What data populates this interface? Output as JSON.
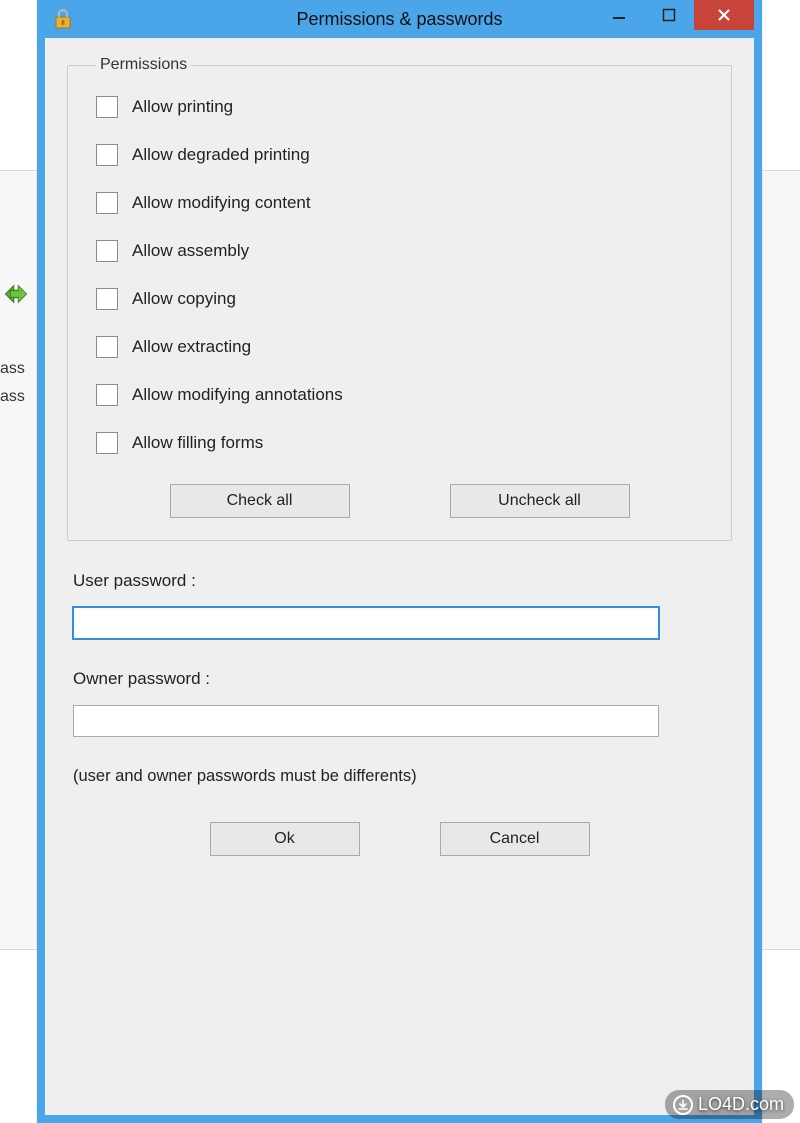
{
  "window": {
    "title": "Permissions & passwords"
  },
  "permissions_group": {
    "legend": "Permissions",
    "items": [
      {
        "label": "Allow printing",
        "checked": false
      },
      {
        "label": "Allow degraded printing",
        "checked": false
      },
      {
        "label": "Allow modifying content",
        "checked": false
      },
      {
        "label": "Allow assembly",
        "checked": false
      },
      {
        "label": "Allow copying",
        "checked": false
      },
      {
        "label": "Allow extracting",
        "checked": false
      },
      {
        "label": "Allow modifying annotations",
        "checked": false
      },
      {
        "label": "Allow filling forms",
        "checked": false
      }
    ],
    "check_all_label": "Check all",
    "uncheck_all_label": "Uncheck all"
  },
  "user_password": {
    "label": "User password :",
    "value": ""
  },
  "owner_password": {
    "label": "Owner password :",
    "value": ""
  },
  "hint_text": "(user and owner passwords must be differents)",
  "footer": {
    "ok_label": "Ok",
    "cancel_label": "Cancel"
  },
  "background": {
    "side_text_1": "ass",
    "side_text_2": "ass"
  },
  "watermark": {
    "text": "LO4D.com"
  }
}
